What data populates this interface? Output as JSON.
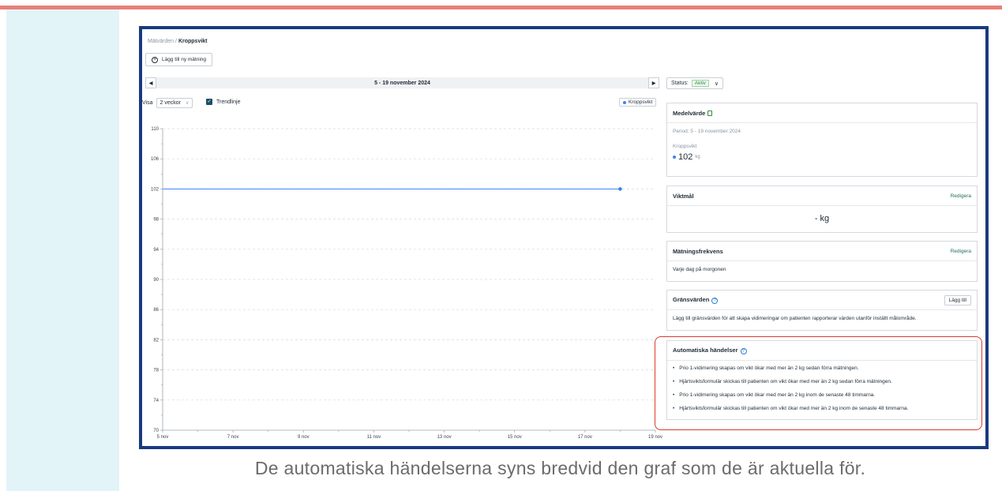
{
  "breadcrumb": {
    "parent": "Mätvärden",
    "separator": "/",
    "current": "Kroppsvikt"
  },
  "add_measurement": {
    "label": "Lägg till ny mätning"
  },
  "period_nav": {
    "label": "5 - 19 november 2024",
    "prev": "◀",
    "next": "▶"
  },
  "view": {
    "label": "Visa",
    "selected": "2 veckor",
    "trend_label": "Trendlinje",
    "legend": "Kroppsvikt"
  },
  "status": {
    "label": "Status:",
    "value": "Aktiv"
  },
  "average_card": {
    "title": "Medelvärde",
    "period": "Period: 5 - 19 november 2024",
    "metric": "Kroppsvikt",
    "value": "102",
    "unit": "kg"
  },
  "goal_card": {
    "title": "Viktmål",
    "edit": "Redigera",
    "value": "- kg"
  },
  "frequency_card": {
    "title": "Mätningsfrekvens",
    "edit": "Redigera",
    "value": "Varje dag på morgonen"
  },
  "limits_card": {
    "title": "Gränsvärden",
    "add": "Lägg till",
    "text": "Lägg till gränsvärden för att skapa vidimeringar om patienten rapporterar värden utanför inställt målområde."
  },
  "events_card": {
    "title": "Automatiska händelser",
    "items": [
      "Prio 1-vidimering skapas om vikt ökar med mer än 2 kg sedan förra mätningen.",
      "Hjärtsviktsformulär skickas till patienten om vikt ökar med mer än 2 kg sedan förra mätningen.",
      "Prio 1-vidimering skapas om vikt ökar med mer än 2 kg inom de senaste 48 timmarna.",
      "Hjärtsviktsformulär skickas till patienten om vikt ökar med mer än 2 kg inom de senaste 48 timmarna."
    ]
  },
  "caption": "De automatiska händelserna syns bredvid den graf som de är aktuella för.",
  "chart_data": {
    "type": "line",
    "x": [
      "5 nov",
      "18 nov"
    ],
    "x_day": [
      5,
      18
    ],
    "y": [
      102,
      102
    ],
    "series": [
      {
        "name": "Kroppsvikt",
        "values": [
          102,
          102
        ]
      }
    ],
    "x_ticks": [
      "5 nov",
      "7 nov",
      "9 nov",
      "11 nov",
      "13 nov",
      "15 nov",
      "17 nov",
      "19 nov"
    ],
    "y_ticks": [
      110,
      106,
      102,
      98,
      94,
      90,
      86,
      82,
      78,
      74,
      70
    ],
    "ylim": [
      70,
      110
    ],
    "xlim_day": [
      5,
      19
    ],
    "color": "#3b82f6",
    "grid": true
  }
}
